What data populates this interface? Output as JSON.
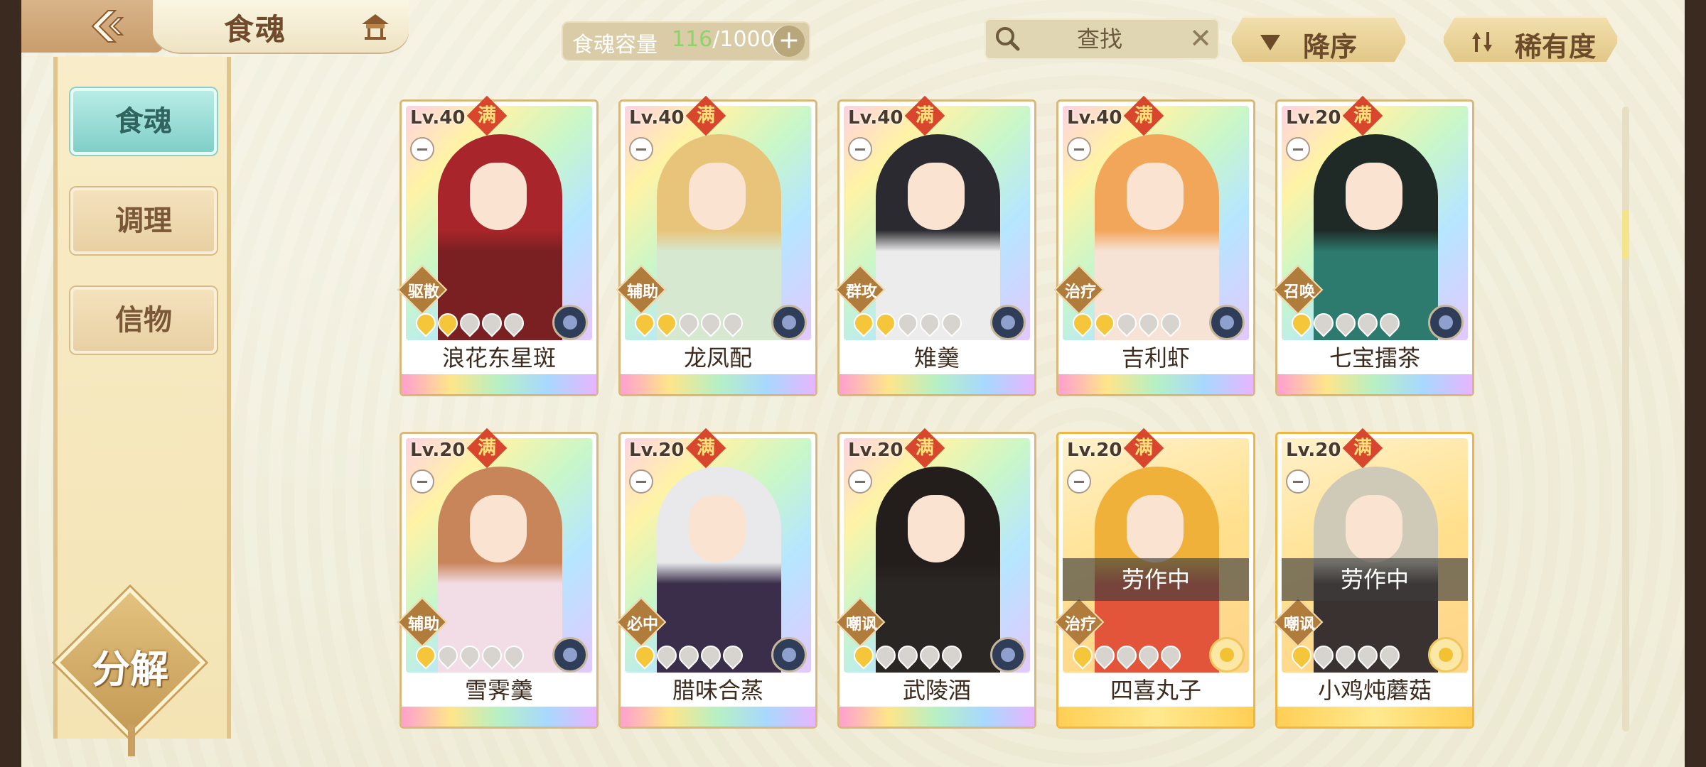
{
  "header": {
    "title": "食魂",
    "capacity_label": "食魂容量",
    "capacity_current": "116",
    "capacity_max": "/1000",
    "capacity_add": "+",
    "search_placeholder": "查找",
    "search_clear": "✕",
    "sort_order_label": "降序",
    "sort_rarity_label": "稀有度"
  },
  "sidebar": {
    "items": [
      {
        "label": "食魂",
        "active": true
      },
      {
        "label": "调理",
        "active": false
      },
      {
        "label": "信物",
        "active": false
      }
    ],
    "decompose_label": "分解"
  },
  "cards": [
    {
      "level": "Lv.40",
      "max": "满",
      "role": "驱散",
      "stars": 2,
      "name": "浪花东星斑",
      "badge": "emblem",
      "frame": "rainbow",
      "status": "",
      "hair": "#a8262b",
      "outfit": "#7a1f22"
    },
    {
      "level": "Lv.40",
      "max": "满",
      "role": "辅助",
      "stars": 2,
      "name": "龙凤配",
      "badge": "emblem",
      "frame": "rainbow",
      "status": "",
      "hair": "#e8c47a",
      "outfit": "#d6e8d0"
    },
    {
      "level": "Lv.40",
      "max": "满",
      "role": "群攻",
      "stars": 2,
      "name": "雉羹",
      "badge": "emblem",
      "frame": "rainbow",
      "status": "",
      "hair": "#2b2a30",
      "outfit": "#ececec"
    },
    {
      "level": "Lv.40",
      "max": "满",
      "role": "治疗",
      "stars": 2,
      "name": "吉利虾",
      "badge": "emblem",
      "frame": "rainbow",
      "status": "",
      "hair": "#f2a65a",
      "outfit": "#f7e3d6"
    },
    {
      "level": "Lv.20",
      "max": "满",
      "role": "召唤",
      "stars": 1,
      "name": "七宝擂茶",
      "badge": "emblem",
      "frame": "rainbow",
      "status": "",
      "hair": "#1f2a27",
      "outfit": "#2d7a6e"
    },
    {
      "level": "Lv.20",
      "max": "满",
      "role": "辅助",
      "stars": 1,
      "name": "雪霁羹",
      "badge": "emblem",
      "frame": "rainbow",
      "status": "",
      "hair": "#c9855a",
      "outfit": "#f2dde6"
    },
    {
      "level": "Lv.20",
      "max": "满",
      "role": "必中",
      "stars": 1,
      "name": "腊味合蒸",
      "badge": "emblem",
      "frame": "rainbow",
      "status": "",
      "hair": "#e9e9ec",
      "outfit": "#3a2e4a"
    },
    {
      "level": "Lv.20",
      "max": "满",
      "role": "嘲讽",
      "stars": 1,
      "name": "武陵酒",
      "badge": "emblem",
      "frame": "rainbow",
      "status": "",
      "hair": "#231d1b",
      "outfit": "#2a2624"
    },
    {
      "level": "Lv.20",
      "max": "满",
      "role": "治疗",
      "stars": 1,
      "name": "四喜丸子",
      "badge": "flower",
      "frame": "gold",
      "status": "劳作中",
      "hair": "#f0b13a",
      "outfit": "#e2553b"
    },
    {
      "level": "Lv.20",
      "max": "满",
      "role": "嘲讽",
      "stars": 1,
      "name": "小鸡炖蘑菇",
      "badge": "flower",
      "frame": "gold",
      "status": "劳作中",
      "hair": "#cfcab8",
      "outfit": "#3a3230"
    }
  ],
  "colors": {
    "accent_teal": "#7fcfc8",
    "gold": "#e2c888",
    "capacity_current": "#8fd26a"
  }
}
